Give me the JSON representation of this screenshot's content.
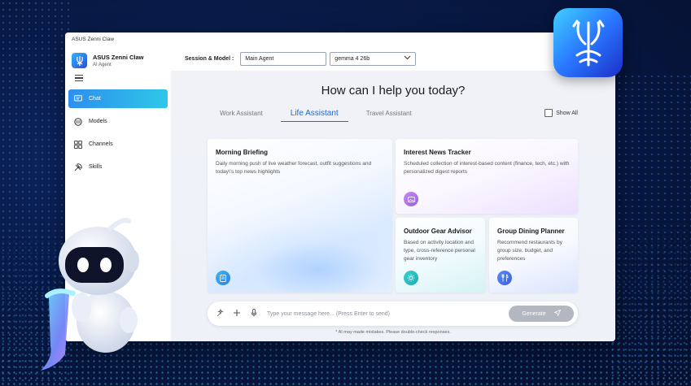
{
  "window": {
    "title": "ASUS Zenni Claw"
  },
  "sidebar": {
    "brand_name": "ASUS Zenni Claw",
    "brand_sub": "AI Agent",
    "items": [
      {
        "label": "Chat",
        "icon": "chat-icon",
        "active": true
      },
      {
        "label": "Models",
        "icon": "models-icon",
        "active": false
      },
      {
        "label": "Channels",
        "icon": "channels-icon",
        "active": false
      },
      {
        "label": "Skills",
        "icon": "skills-icon",
        "active": false
      }
    ]
  },
  "session": {
    "label": "Session & Model :",
    "agent_value": "Main Agent",
    "model_value": "gemma 4 26b"
  },
  "main": {
    "headline": "How can I help you today?",
    "tabs": [
      {
        "label": "Work Assistant",
        "active": false
      },
      {
        "label": "Life Assistant",
        "active": true
      },
      {
        "label": "Travel Assistant",
        "active": false
      }
    ],
    "show_all": "Show All",
    "cards": [
      {
        "title": "Morning Briefing",
        "desc": "Daily morning push of live weather forecast, outfit suggestions and today\\'s top news highlights",
        "icon": "document-icon"
      },
      {
        "title": "Interest News Tracker",
        "desc": "Scheduled collection of interest-based content (finance, tech, etc.) with personalized digest reports",
        "icon": "image-icon"
      },
      {
        "title": "Outdoor Gear Advisor",
        "desc": "Based on activity location and type, cross-reference personal gear inventory",
        "icon": "sun-icon"
      },
      {
        "title": "Group Dining Planner",
        "desc": "Recommend restaurants by group size, budget, and preferences",
        "icon": "utensils-icon"
      }
    ]
  },
  "composer": {
    "placeholder": "Type your message here... (Press Enter to send)",
    "generate_label": "Generate",
    "disclaimer": "* AI may made mistakes. Please double-check responses."
  },
  "colors": {
    "accent": "#1c6bd6",
    "active_nav_start": "#2d8ff0",
    "active_nav_end": "#2fc7e8",
    "background": "#081a47"
  }
}
